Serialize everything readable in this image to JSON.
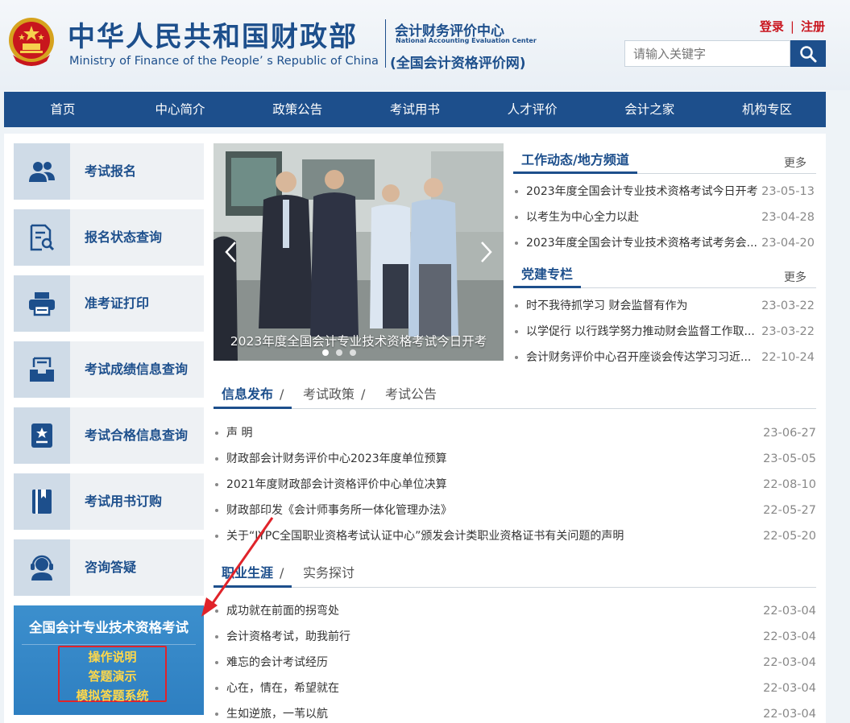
{
  "header": {
    "title_cn": "中华人民共和国财政部",
    "title_en": "Ministry of Finance of the People’ s Republic of China",
    "center_cn": "会计财务评价中心",
    "center_en": "National Accounting Evaluation Center",
    "center_sub": "(全国会计资格评价网)",
    "login": "登录",
    "register": "注册",
    "search_placeholder": "请输入关键字"
  },
  "nav": [
    "首页",
    "中心简介",
    "政策公告",
    "考试用书",
    "人才评价",
    "会计之家",
    "机构专区"
  ],
  "sidebar": {
    "tiles": [
      {
        "label": "考试报名",
        "icon": "users-icon"
      },
      {
        "label": "报名状态查询",
        "icon": "document-search-icon"
      },
      {
        "label": "准考证打印",
        "icon": "printer-icon"
      },
      {
        "label": "考试成绩信息查询",
        "icon": "inbox-icon"
      },
      {
        "label": "考试合格信息查询",
        "icon": "certificate-icon"
      },
      {
        "label": "考试用书订购",
        "icon": "book-icon"
      },
      {
        "label": "咨询答疑",
        "icon": "headset-icon"
      }
    ],
    "exam_panel": {
      "title": "全国会计专业技术资格考试",
      "links": [
        "操作说明",
        "答题演示",
        "模拟答题系统"
      ]
    }
  },
  "carousel": {
    "caption": "2023年度全国会计专业技术资格考试今日开考"
  },
  "news_sections": [
    {
      "title": "工作动态/地方频道",
      "more": "更多",
      "items": [
        {
          "text": "2023年度全国会计专业技术资格考试今日开考",
          "date": "23-05-13"
        },
        {
          "text": "以考生为中心全力以赴",
          "date": "23-04-28"
        },
        {
          "text": "2023年度全国会计专业技术资格考试考务会...",
          "date": "23-04-20"
        }
      ]
    },
    {
      "title": "党建专栏",
      "more": "更多",
      "items": [
        {
          "text": "时不我待抓学习 财会监督有作为",
          "date": "23-03-22"
        },
        {
          "text": "以学促行 以行践学努力推动财会监督工作取...",
          "date": "23-03-22"
        },
        {
          "text": "会计财务评价中心召开座谈会传达学习习近...",
          "date": "22-10-24"
        }
      ]
    }
  ],
  "info_block": {
    "tabs": [
      "信息发布",
      "考试政策",
      "考试公告"
    ],
    "items": [
      {
        "text": "声 明",
        "date": "23-06-27"
      },
      {
        "text": "财政部会计财务评价中心2023年度单位预算",
        "date": "23-05-05"
      },
      {
        "text": "2021年度财政部会计资格评价中心单位决算",
        "date": "22-08-10"
      },
      {
        "text": "财政部印发《会计师事务所一体化管理办法》",
        "date": "22-05-27"
      },
      {
        "text": "关于“JYPC全国职业资格考试认证中心”颁发会计类职业资格证书有关问题的声明",
        "date": "22-05-20"
      }
    ]
  },
  "career_block": {
    "tabs": [
      "职业生涯",
      "实务探讨"
    ],
    "items": [
      {
        "text": "成功就在前面的拐弯处",
        "date": "22-03-04"
      },
      {
        "text": "会计资格考试，助我前行",
        "date": "22-03-04"
      },
      {
        "text": "难忘的会计考试经历",
        "date": "22-03-04"
      },
      {
        "text": "心在，情在，希望就在",
        "date": "22-03-04"
      },
      {
        "text": "生如逆旅，一苇以航",
        "date": "22-03-04"
      }
    ]
  },
  "colors": {
    "brand": "#1d4f8c",
    "accent": "#c9151e",
    "highlight": "#ffd84a"
  }
}
